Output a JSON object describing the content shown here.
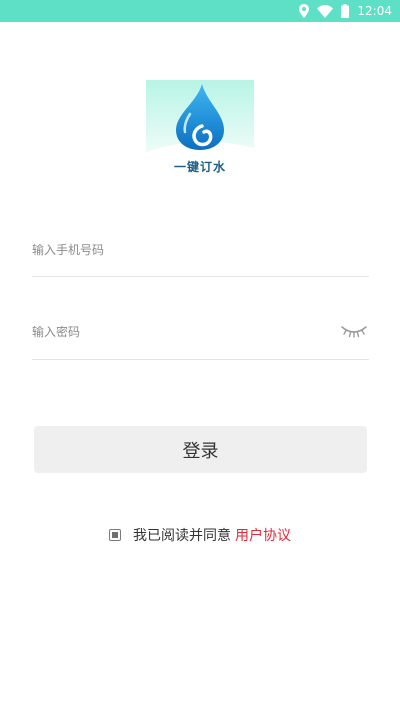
{
  "status_bar": {
    "time": "12:04",
    "color": "#5de0c6"
  },
  "logo": {
    "text": "一键订水",
    "text_color": "#1c5f87"
  },
  "form": {
    "phone_placeholder": "输入手机号码",
    "password_placeholder": "输入密码",
    "login_label": "登录"
  },
  "agreement": {
    "text": "我已阅读并同意",
    "link_label": "用户协议",
    "link_color": "#e02b3a",
    "checked": true
  },
  "icons": {
    "location": "location-icon",
    "wifi": "wifi-icon",
    "battery": "battery-icon",
    "water_drop": "water-drop-icon",
    "eye": "eye-closed-icon"
  }
}
